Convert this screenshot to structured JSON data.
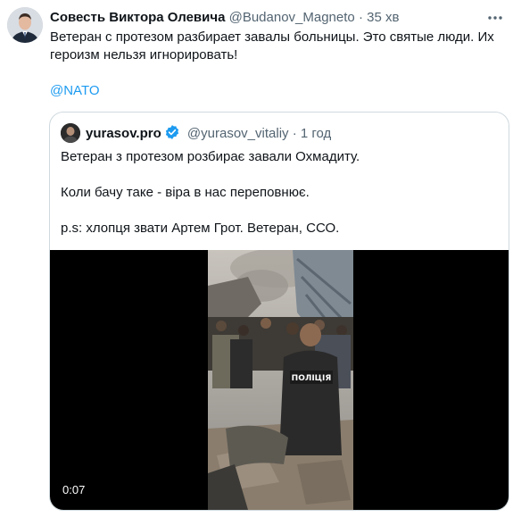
{
  "tweet": {
    "author_name": "Совесть Виктора Олевича",
    "author_handle": "@Budanov_Magneto",
    "separator": "·",
    "time": "35 хв",
    "text_line1": "Ветеран с протезом разбирает завалы больницы. Это святые люди. Их",
    "text_line2": "героизм нельзя игнорировать!",
    "mention": "@NATO"
  },
  "quote": {
    "author_name": "yurasov.pro",
    "author_handle": "@yurasov_vitaliy",
    "separator": "·",
    "time": "1 год",
    "line1": "Ветеран з протезом розбирає завали Охмадиту.",
    "line2": "Коли бачу таке - віра в нас переповнює.",
    "line3": "p.s: хлопця звати Артем Грот. Ветеран, ССО.",
    "video": {
      "duration": "0:07",
      "vest_label": "ПОЛІЦІЯ"
    }
  },
  "colors": {
    "link": "#1d9bf0",
    "secondary_text": "#536471",
    "border": "#cfd9de",
    "verified": "#1d9bf0"
  },
  "icons": [
    "more-icon",
    "verified-icon"
  ]
}
